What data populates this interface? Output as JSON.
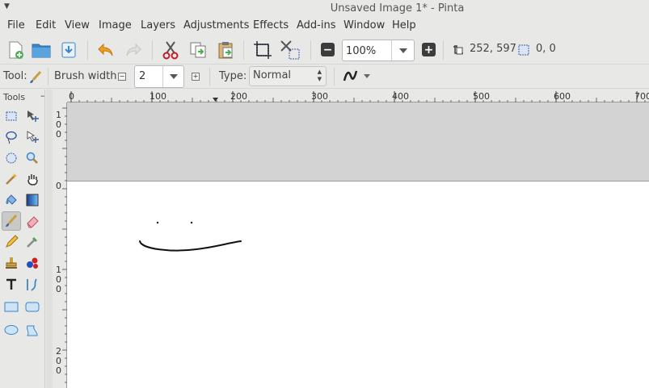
{
  "window": {
    "title": "Unsaved Image 1* - Pinta"
  },
  "menu": [
    "File",
    "Edit",
    "View",
    "Image",
    "Layers",
    "Adjustments",
    "Effects",
    "Add-ins",
    "Window",
    "Help"
  ],
  "toolbar": {
    "zoom_value": "100%",
    "image_size": "252, 597",
    "cursor_position": "0, 0"
  },
  "tool_options": {
    "tool_label": "Tool:",
    "brush_width_label": "Brush width:",
    "brush_width_value": "2",
    "type_label": "Type:",
    "type_value": "Normal"
  },
  "tools_panel": {
    "title": "Tools",
    "minimize": "–"
  },
  "rulers": {
    "horizontal_ticks": [
      "0",
      "100",
      "200",
      "300",
      "400",
      "500",
      "600",
      "700"
    ],
    "vertical_labels": [
      {
        "digits": [
          "1",
          "0",
          "0"
        ]
      },
      {
        "digits": [
          "0"
        ]
      },
      {
        "digits": [
          "1",
          "0",
          "0"
        ]
      },
      {
        "digits": [
          "2",
          "0",
          "0"
        ]
      }
    ]
  },
  "colors": {
    "accent": "#3584e4",
    "danger": "#c01c28",
    "canvas_bg": "#d3d3d3"
  },
  "icons": {
    "new": "new-image-icon",
    "open": "open-folder-icon",
    "save": "save-icon",
    "undo": "undo-icon",
    "redo": "redo-icon",
    "cut": "cut-icon",
    "copy": "copy-icon",
    "paste": "paste-icon",
    "crop": "crop-icon",
    "deselect": "deselect-icon",
    "zoom_out": "zoom-out-icon",
    "zoom_in": "zoom-in-icon"
  }
}
